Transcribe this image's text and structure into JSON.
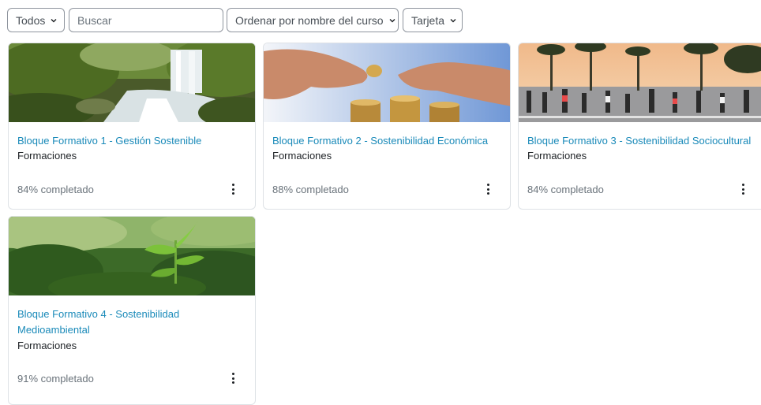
{
  "filters": {
    "grouping": "Todos",
    "search_placeholder": "Buscar",
    "sort": "Ordenar por nombre del curso",
    "view": "Tarjeta"
  },
  "courses": [
    {
      "title": "Bloque Formativo 1 - Gestión Sostenible",
      "category": "Formaciones",
      "progress_text": "84% completado",
      "progress": 84,
      "image": "waterfall-forest"
    },
    {
      "title": "Bloque Formativo 2 - Sostenibilidad Económica",
      "category": "Formaciones",
      "progress_text": "88% completado",
      "progress": 88,
      "image": "hands-stacking-coins"
    },
    {
      "title": "Bloque Formativo 3 - Sostenibilidad Sociocultural",
      "category": "Formaciones",
      "progress_text": "84% completado",
      "progress": 84,
      "image": "crowded-street-palm-trees"
    },
    {
      "title": "Bloque Formativo 4 - Sostenibilidad Medioambiental",
      "category": "Formaciones",
      "progress_text": "91% completado",
      "progress": 91,
      "image": "green-seedling"
    }
  ],
  "colors": {
    "link": "#1a8ab9",
    "border": "#dee2e6",
    "muted": "#6a737b"
  },
  "icons": {
    "dropdown": "chevron-down-icon",
    "card_menu": "kebab-menu-icon"
  }
}
